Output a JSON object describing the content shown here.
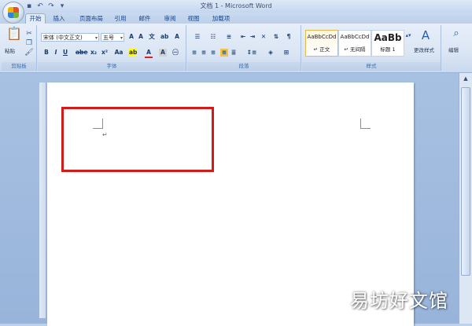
{
  "window": {
    "title": "文档 1 - Microsoft Word"
  },
  "tabs": [
    "开始",
    "插入",
    "页面布局",
    "引用",
    "邮件",
    "审阅",
    "视图",
    "加载项"
  ],
  "active_tab": "开始",
  "ribbon": {
    "clipboard": {
      "paste_label": "粘贴",
      "group_label": "剪贴板"
    },
    "font": {
      "font_name": "宋体 (中文正文)",
      "font_size": "五号",
      "buttons": [
        "B",
        "I",
        "U",
        "abe",
        "x₂",
        "x²",
        "Aa",
        "A",
        "A"
      ],
      "group_label": "字体"
    },
    "paragraph": {
      "group_label": "段落"
    },
    "styles": {
      "items": [
        {
          "sample": "AaBbCcDd",
          "name": "↵ 正文"
        },
        {
          "sample": "AaBbCcDd",
          "name": "↵ 无间隔"
        },
        {
          "sample": "AaBb",
          "name": "标题 1"
        }
      ],
      "change_styles_label": "更改样式",
      "group_label": "样式"
    },
    "editing": {
      "label": "编辑"
    }
  },
  "document": {
    "paragraph_mark": "↵"
  },
  "watermark": "易坊好文馆",
  "colors": {
    "highlight_border": "#d11a1a",
    "ribbon_bg": "#dbe6f4",
    "workspace_bg": "#a7c1e2"
  }
}
